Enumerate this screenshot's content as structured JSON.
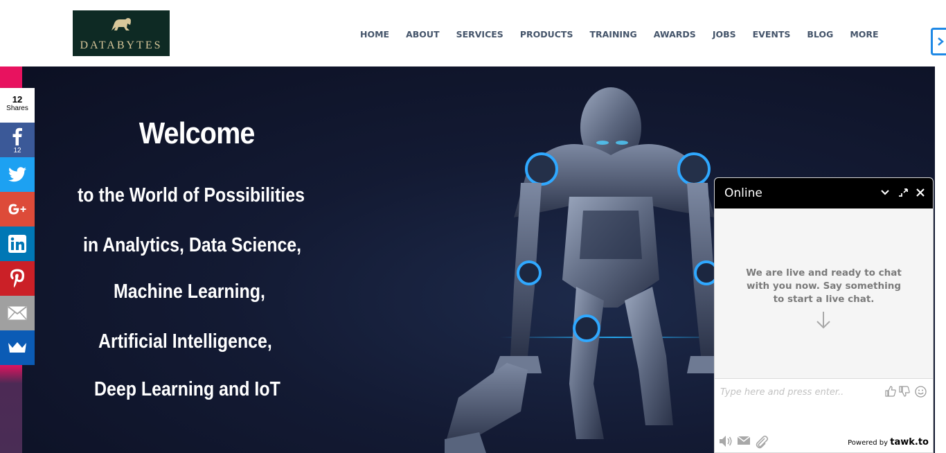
{
  "header": {
    "logo_text": "DATABYTES",
    "nav": [
      {
        "label": "HOME"
      },
      {
        "label": "ABOUT"
      },
      {
        "label": "SERVICES"
      },
      {
        "label": "PRODUCTS"
      },
      {
        "label": "TRAINING"
      },
      {
        "label": "AWARDS"
      },
      {
        "label": "JOBS"
      },
      {
        "label": "EVENTS"
      },
      {
        "label": "BLOG"
      },
      {
        "label": "MORE"
      }
    ]
  },
  "hero": {
    "title": "Welcome",
    "lines": [
      "to the World of Possibilities",
      "in Analytics, Data Science,",
      "Machine Learning,",
      "Artificial Intelligence,",
      "Deep Learning and IoT"
    ]
  },
  "share": {
    "count": "12",
    "count_label": "Shares",
    "facebook_count": "12",
    "buttons": [
      {
        "name": "facebook",
        "color": "#3b5998",
        "icon": "facebook-icon"
      },
      {
        "name": "twitter",
        "color": "#1da1f2",
        "icon": "twitter-icon"
      },
      {
        "name": "google-plus",
        "color": "#dd4b39",
        "icon": "google-plus-icon"
      },
      {
        "name": "linkedin",
        "color": "#0077b5",
        "icon": "linkedin-icon"
      },
      {
        "name": "pinterest",
        "color": "#cb2027",
        "icon": "pinterest-icon"
      },
      {
        "name": "email",
        "color": "#a0a0a0",
        "icon": "email-icon"
      },
      {
        "name": "sumo",
        "color": "#0b5bb5",
        "icon": "crown-icon"
      }
    ]
  },
  "chat": {
    "status": "Online",
    "message": "We are live and ready to chat with you now. Say something to start a live chat.",
    "input_placeholder": "Type here and press enter..",
    "powered_by": "Powered by",
    "brand": "tawk.to"
  },
  "colors": {
    "accent_strip": "#e8125f",
    "nav_text": "#44546a",
    "hero_bg": "#0c1023"
  }
}
